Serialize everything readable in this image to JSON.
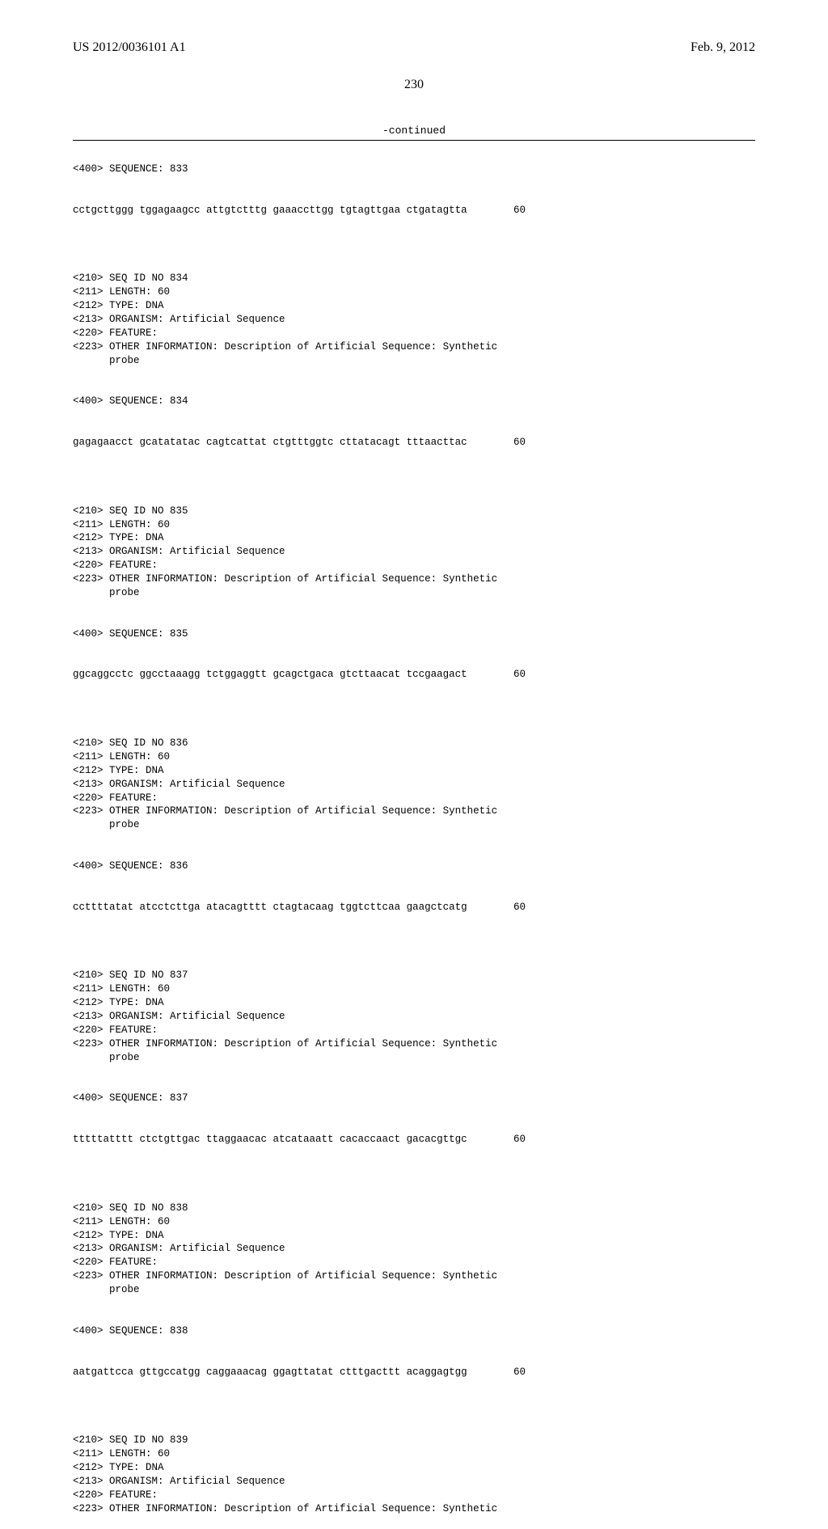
{
  "header": {
    "pub_id": "US 2012/0036101 A1",
    "pub_date": "Feb. 9, 2012"
  },
  "page_number": "230",
  "continued_label": "-continued",
  "entries": [
    {
      "sequence_header": "<400> SEQUENCE: 833",
      "sequence_line": "cctgcttggg tggagaagcc attgtctttg gaaaccttgg tgtagttgaa ctgatagtta",
      "sequence_num": "60",
      "block": [
        "<210> SEQ ID NO 834",
        "<211> LENGTH: 60",
        "<212> TYPE: DNA",
        "<213> ORGANISM: Artificial Sequence",
        "<220> FEATURE:",
        "<223> OTHER INFORMATION: Description of Artificial Sequence: Synthetic",
        "      probe"
      ],
      "block_seq_header": "<400> SEQUENCE: 834",
      "block_seq_line": "gagagaacct gcatatatac cagtcattat ctgtttggtc cttatacagt tttaacttac",
      "block_seq_num": "60"
    },
    {
      "block": [
        "<210> SEQ ID NO 835",
        "<211> LENGTH: 60",
        "<212> TYPE: DNA",
        "<213> ORGANISM: Artificial Sequence",
        "<220> FEATURE:",
        "<223> OTHER INFORMATION: Description of Artificial Sequence: Synthetic",
        "      probe"
      ],
      "block_seq_header": "<400> SEQUENCE: 835",
      "block_seq_line": "ggcaggcctc ggcctaaagg tctggaggtt gcagctgaca gtcttaacat tccgaagact",
      "block_seq_num": "60"
    },
    {
      "block": [
        "<210> SEQ ID NO 836",
        "<211> LENGTH: 60",
        "<212> TYPE: DNA",
        "<213> ORGANISM: Artificial Sequence",
        "<220> FEATURE:",
        "<223> OTHER INFORMATION: Description of Artificial Sequence: Synthetic",
        "      probe"
      ],
      "block_seq_header": "<400> SEQUENCE: 836",
      "block_seq_line": "ccttttatat atcctcttga atacagtttt ctagtacaag tggtcttcaa gaagctcatg",
      "block_seq_num": "60"
    },
    {
      "block": [
        "<210> SEQ ID NO 837",
        "<211> LENGTH: 60",
        "<212> TYPE: DNA",
        "<213> ORGANISM: Artificial Sequence",
        "<220> FEATURE:",
        "<223> OTHER INFORMATION: Description of Artificial Sequence: Synthetic",
        "      probe"
      ],
      "block_seq_header": "<400> SEQUENCE: 837",
      "block_seq_line": "tttttatttt ctctgttgac ttaggaacac atcataaatt cacaccaact gacacgttgc",
      "block_seq_num": "60"
    },
    {
      "block": [
        "<210> SEQ ID NO 838",
        "<211> LENGTH: 60",
        "<212> TYPE: DNA",
        "<213> ORGANISM: Artificial Sequence",
        "<220> FEATURE:",
        "<223> OTHER INFORMATION: Description of Artificial Sequence: Synthetic",
        "      probe"
      ],
      "block_seq_header": "<400> SEQUENCE: 838",
      "block_seq_line": "aatgattcca gttgccatgg caggaaacag ggagttatat ctttgacttt acaggagtgg",
      "block_seq_num": "60"
    },
    {
      "block": [
        "<210> SEQ ID NO 839",
        "<211> LENGTH: 60",
        "<212> TYPE: DNA",
        "<213> ORGANISM: Artificial Sequence",
        "<220> FEATURE:",
        "<223> OTHER INFORMATION: Description of Artificial Sequence: Synthetic"
      ]
    }
  ]
}
